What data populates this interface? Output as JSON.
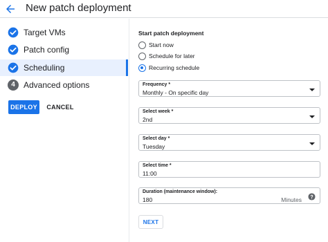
{
  "header": {
    "title": "New patch deployment",
    "back_icon": "arrow-back-icon"
  },
  "stepper": {
    "accent": "#1a73e8",
    "steps": [
      {
        "label": "Target VMs",
        "state": "complete",
        "icon": "check-circle-icon"
      },
      {
        "label": "Patch config",
        "state": "complete",
        "icon": "check-circle-icon"
      },
      {
        "label": "Scheduling",
        "state": "active",
        "icon": "check-circle-icon"
      },
      {
        "label": "Advanced options",
        "state": "pending",
        "number": "4"
      }
    ]
  },
  "actions": {
    "deploy_label": "DEPLOY",
    "cancel_label": "CANCEL"
  },
  "form": {
    "section_title": "Start patch deployment",
    "radios": [
      {
        "label": "Start now",
        "checked": false
      },
      {
        "label": "Schedule for later",
        "checked": false
      },
      {
        "label": "Recurring schedule",
        "checked": true
      }
    ],
    "frequency": {
      "label": "Frequency *",
      "value": "Monthly - On specific day"
    },
    "week": {
      "label": "Select week *",
      "value": "2nd"
    },
    "day": {
      "label": "Select day *",
      "value": "Tuesday"
    },
    "time": {
      "label": "Select time *",
      "value": "11:00"
    },
    "duration": {
      "label": "Duration (maintenance window):",
      "value": "180",
      "suffix": "Minutes",
      "help_icon": "help-icon"
    },
    "next_label": "NEXT"
  }
}
